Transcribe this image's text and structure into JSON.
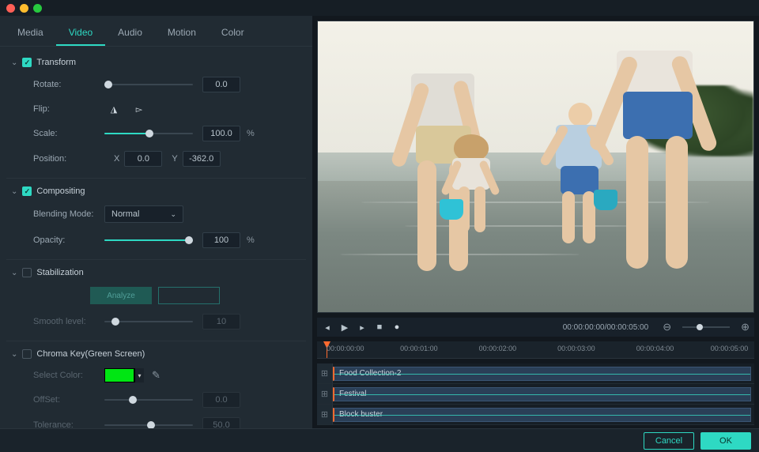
{
  "tabs": [
    "Media",
    "Video",
    "Audio",
    "Motion",
    "Color"
  ],
  "activeTab": "Video",
  "sections": {
    "transform": {
      "title": "Transform",
      "rotate": {
        "label": "Rotate:",
        "value": "0.0"
      },
      "flip": {
        "label": "Flip:"
      },
      "scale": {
        "label": "Scale:",
        "value": "100.0",
        "unit": "%"
      },
      "position": {
        "label": "Position:",
        "x": "0.0",
        "y": "-362.0",
        "xlabel": "X",
        "ylabel": "Y"
      }
    },
    "compositing": {
      "title": "Compositing",
      "blend": {
        "label": "Blending Mode:",
        "value": "Normal"
      },
      "opacity": {
        "label": "Opacity:",
        "value": "100",
        "unit": "%"
      }
    },
    "stabilization": {
      "title": "Stabilization",
      "analyze": "Analyze",
      "smooth": {
        "label": "Smooth level:",
        "value": "10"
      }
    },
    "chroma": {
      "title": "Chroma Key(Green Screen)",
      "select": {
        "label": "Select Color:"
      },
      "offset": {
        "label": "OffSet:",
        "value": "0.0"
      },
      "tolerance": {
        "label": "Tolerance:",
        "value": "50.0"
      }
    }
  },
  "transport": {
    "timecode": "00:00:00:00/00:00:05:00"
  },
  "ruler": [
    "00:00:00:00",
    "00:00:01:00",
    "00:00:02:00",
    "00:00:03:00",
    "00:00:04:00",
    "00:00:05:00"
  ],
  "tracks": [
    {
      "label": "Food Collection-2"
    },
    {
      "label": "Festival"
    },
    {
      "label": "Block buster"
    }
  ],
  "footer": {
    "cancel": "Cancel",
    "ok": "OK"
  }
}
